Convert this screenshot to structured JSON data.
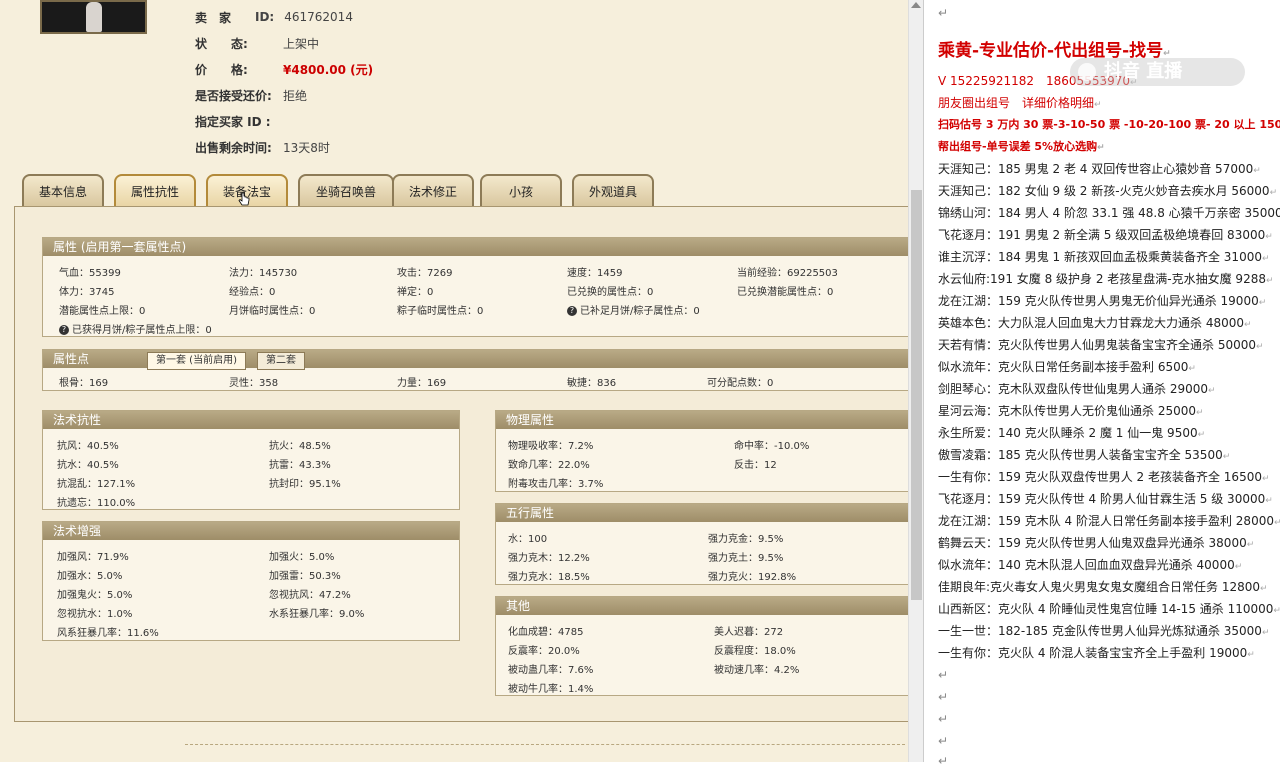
{
  "seller": {
    "label_seller": "卖　家",
    "seller_id_label": "ID:",
    "seller_id": "461762014",
    "label_status": "状　　态:",
    "status": "上架中",
    "label_price": "价　　格:",
    "price": "¥4800.00 (元)",
    "label_counter": "是否接受还价:",
    "counter": "拒绝",
    "label_buyer": "指定买家 ID :",
    "label_time": "出售剩余时间:",
    "time": "13天8时"
  },
  "tabs": [
    "基本信息",
    "属性抗性",
    "装备法宝",
    "坐骑召唤兽",
    "法术修正",
    "小孩",
    "外观道具"
  ],
  "attrs": {
    "title": "属性 (启用第一套属性点)",
    "row1": [
      "气血：55399",
      "法力：145730",
      "攻击：7269",
      "速度：1459",
      "当前经验：69225503"
    ],
    "row2": [
      "体力：3745",
      "经验点：0",
      "禅定：0",
      "已兑换的属性点：0",
      "已兑换潜能属性点：0"
    ],
    "row3": [
      "潜能属性点上限：0",
      "月饼临时属性点：0",
      "粽子临时属性点：0",
      "已补足月饼/粽子属性点：0"
    ],
    "row4": "已获得月饼/粽子属性点上限：0"
  },
  "points": {
    "title": "属性点",
    "tab1": "第一套 (当前启用)",
    "tab2": "第二套",
    "row": [
      "根骨：169",
      "灵性：358",
      "力量：169",
      "敏捷：836",
      "可分配点数：0"
    ]
  },
  "magic_res": {
    "title": "法术抗性",
    "items": [
      "抗风：40.5%",
      "抗火：48.5%",
      "抗水：40.5%",
      "抗雷：43.3%",
      "抗混乱：127.1%",
      "抗封印：95.1%",
      "抗遗忘：110.0%"
    ]
  },
  "magic_boost": {
    "title": "法术增强",
    "items": [
      "加强风：71.9%",
      "加强火：5.0%",
      "加强水：5.0%",
      "加强雷：50.3%",
      "加强鬼火：5.0%",
      "忽视抗风：47.2%",
      "忽视抗水：1.0%",
      "水系狂暴几率：9.0%",
      "风系狂暴几率：11.6%"
    ]
  },
  "physical": {
    "title": "物理属性",
    "items": [
      "物理吸收率：7.2%",
      "命中率：-10.0%",
      "致命几率：22.0%",
      "反击：12",
      "附毒攻击几率：3.7%"
    ]
  },
  "elements": {
    "title": "五行属性",
    "items": [
      "水：100",
      "强力克金：9.5%",
      "强力克木：12.2%",
      "强力克土：9.5%",
      "强力克水：18.5%",
      "强力克火：192.8%"
    ]
  },
  "other": {
    "title": "其他",
    "items": [
      "化血成碧：4785",
      "美人迟暮：272",
      "反震率：20.0%",
      "反震程度：18.0%",
      "被动蛊几率：7.6%",
      "被动速几率：4.2%",
      "被动牛几率：1.4%"
    ]
  },
  "right_panel": {
    "watermark": "抖音 直播",
    "lines": [
      {
        "cls": "title",
        "text": "乘黄-专业估价-代出组号-找号"
      },
      {
        "cls": "red",
        "text": " V 15225921182　18605553970"
      },
      {
        "cls": "red",
        "text": "朋友圈出组号　详细价格明细"
      },
      {
        "cls": "redb",
        "text": "扫码估号 3 万内 30 票-3-10-50 票 -10-20-100 票- 20 以上 150"
      },
      {
        "cls": "redb",
        "text": "帮出组号-单号误差 5%放心选购"
      },
      {
        "cls": "",
        "text": "天涯知己：185 男鬼 2 老 4 双回传世容止心猿妙音 57000"
      },
      {
        "cls": "",
        "text": "天涯知己：182 女仙 9 级 2 新孩-火克火妙音去疾水月 56000"
      },
      {
        "cls": "",
        "text": "锦绣山河：184 男人 4 阶忽 33.1 强 48.8 心猿千万亲密 35000"
      },
      {
        "cls": "",
        "text": "飞花逐月：191 男鬼 2 新全满 5 级双回孟极绝境春回 83000"
      },
      {
        "cls": "",
        "text": "谁主沉浮：184 男鬼 1 新孩双回血孟极乘黄装备齐全 31000"
      },
      {
        "cls": "",
        "text": "水云仙府:191 女魔 8 级护身 2 老孩星盘满-克水抽女魔 9288"
      },
      {
        "cls": "",
        "text": "龙在江湖：159 克火队传世男人男鬼无价仙异光通杀 19000"
      },
      {
        "cls": "",
        "text": "英雄本色：大力队混人回血鬼大力甘霖龙大力通杀 48000"
      },
      {
        "cls": "",
        "text": "天若有情：克火队传世男人仙男鬼装备宝宝齐全通杀 50000"
      },
      {
        "cls": "",
        "text": "似水流年：克火队日常任务副本接手盈利 6500"
      },
      {
        "cls": "",
        "text": "剑胆琴心：克木队双盘队传世仙鬼男人通杀 29000"
      },
      {
        "cls": "",
        "text": "星河云海：克木队传世男人无价鬼仙通杀 25000"
      },
      {
        "cls": "",
        "text": "永生所爱：140 克火队睡杀 2 魔 1 仙一鬼 9500"
      },
      {
        "cls": "",
        "text": "傲雪凌霜：185 克火队传世男人装备宝宝齐全 53500"
      },
      {
        "cls": "",
        "text": "一生有你：159 克火队双盘传世男人 2 老孩装备齐全 16500"
      },
      {
        "cls": "",
        "text": "飞花逐月：159 克火队传世 4 阶男人仙甘霖生活 5 级 30000"
      },
      {
        "cls": "",
        "text": "龙在江湖：159 克木队 4 阶混人日常任务副本接手盈利 28000"
      },
      {
        "cls": "",
        "text": "鹤舞云天：159 克火队传世男人仙鬼双盘异光通杀 38000"
      },
      {
        "cls": "",
        "text": "似水流年：140 克木队混人回血血双盘异光通杀 40000"
      },
      {
        "cls": "",
        "text": "佳期良年:克火毒女人鬼火男鬼女鬼女魔组合日常任务 12800"
      },
      {
        "cls": "",
        "text": "山西新区：克火队 4 阶睡仙灵性鬼宫位睡 14-15 通杀 110000"
      },
      {
        "cls": "",
        "text": "一生一世：182-185 克金队传世男人仙异光炼狱通杀 35000"
      },
      {
        "cls": "",
        "text": "一生有你：克火队 4 阶混人装备宝宝齐全上手盈利 19000"
      }
    ]
  }
}
